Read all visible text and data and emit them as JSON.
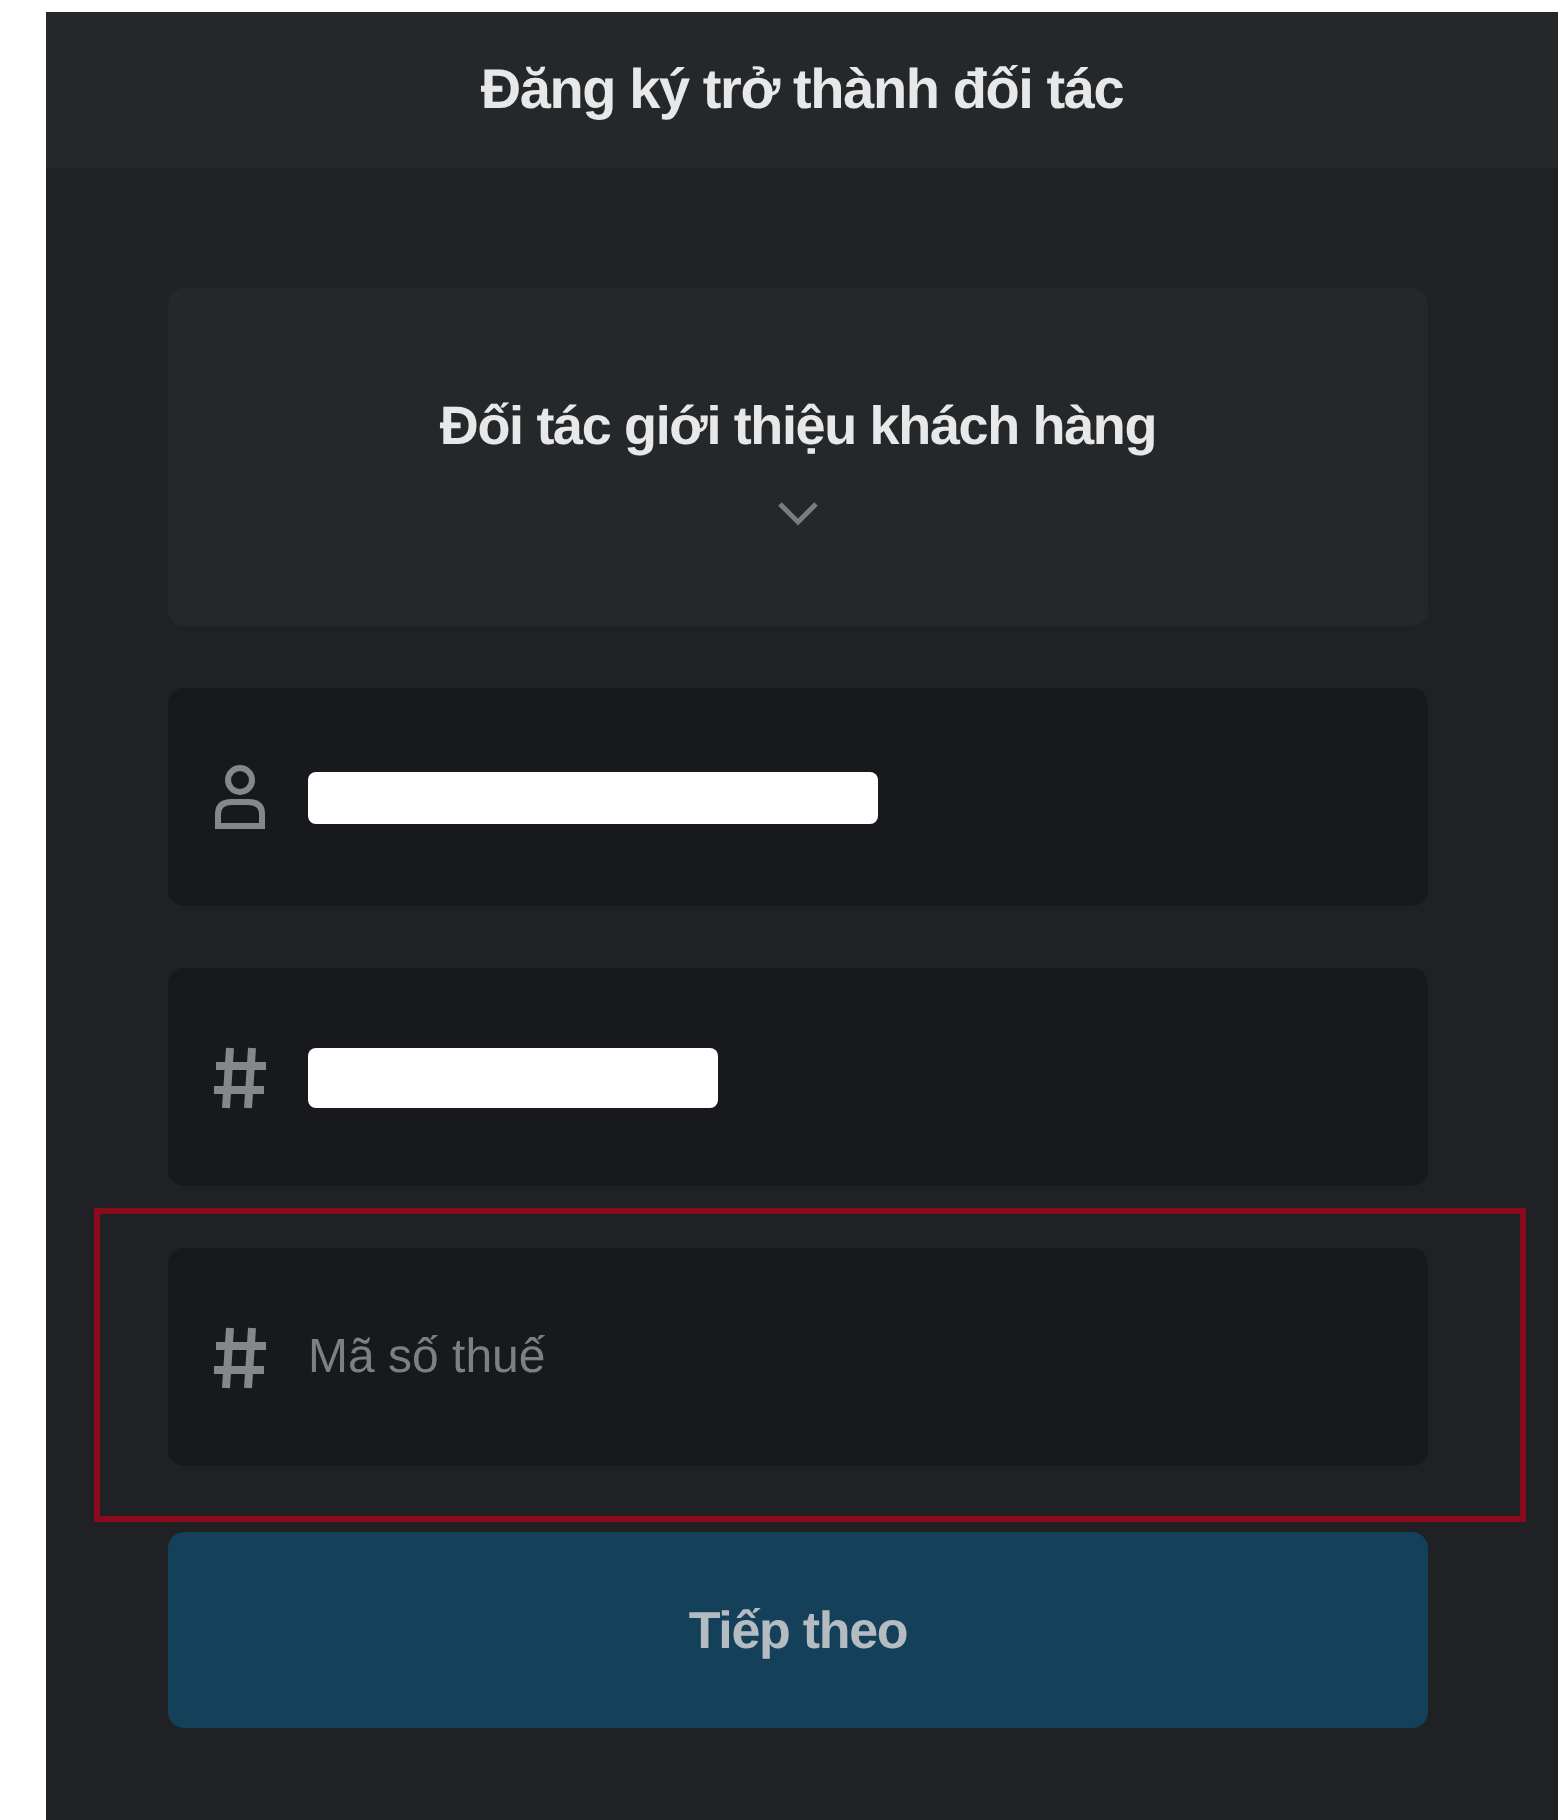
{
  "header": {
    "title": "Đăng ký trở thành đối tác"
  },
  "partner_type": {
    "label": "Đối tác giới thiệu khách hàng",
    "expanded": false
  },
  "fields": [
    {
      "kind": "person",
      "redacted": true,
      "highlighted": false
    },
    {
      "kind": "hash",
      "redacted": true,
      "highlighted": false
    },
    {
      "kind": "hash",
      "redacted": false,
      "placeholder": "Mã số thuế",
      "highlighted": true
    }
  ],
  "next_button": {
    "label": "Tiếp theo"
  }
}
